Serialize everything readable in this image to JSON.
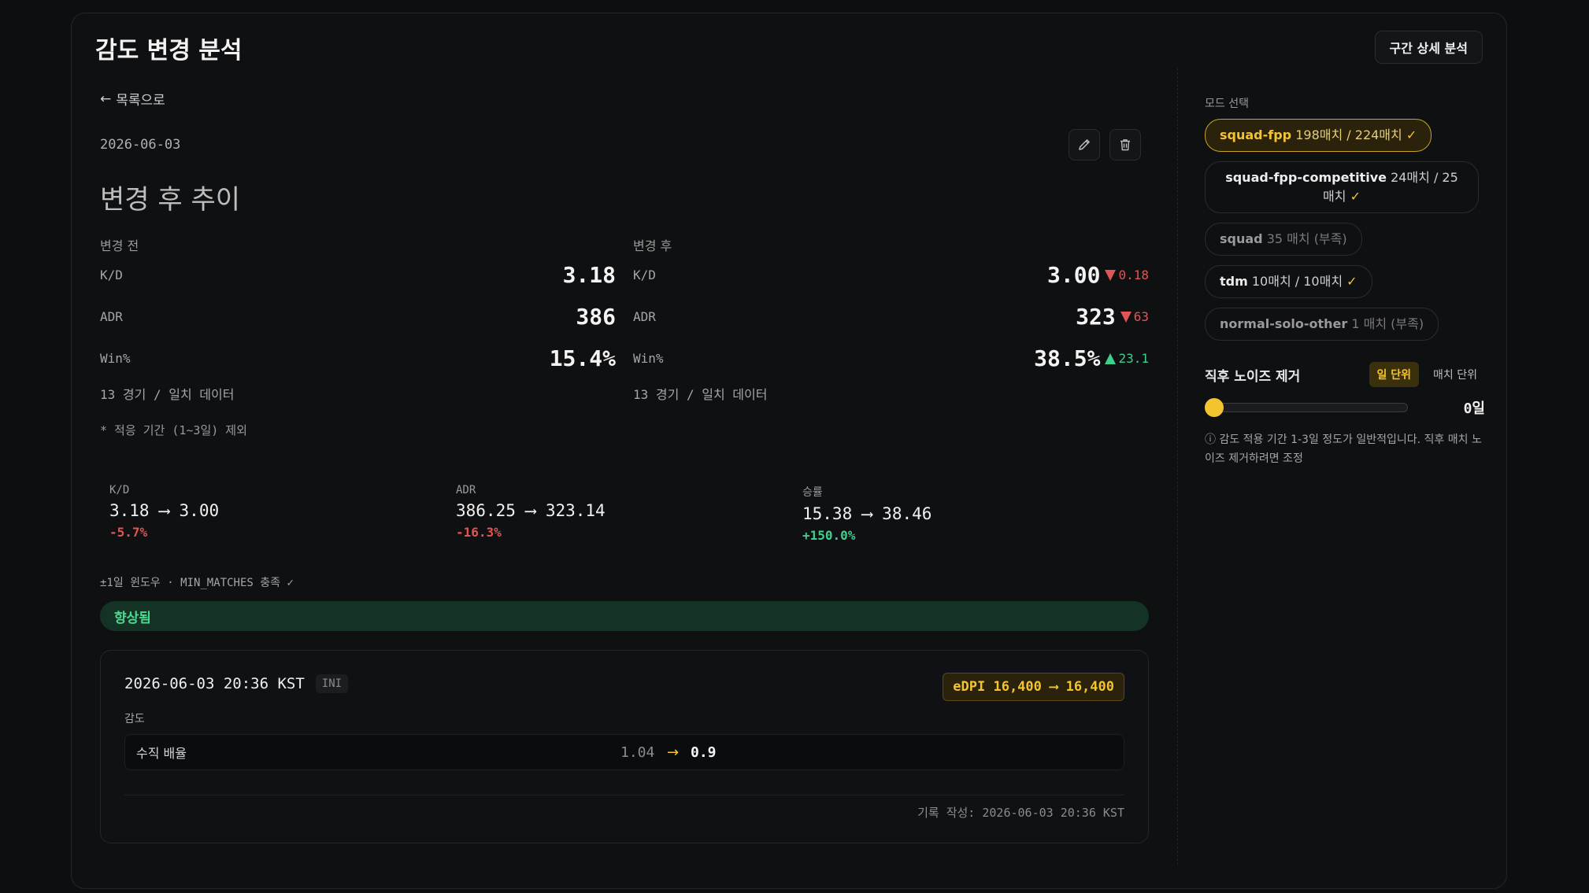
{
  "header": {
    "title": "감도 변경 분석",
    "detail_button": "구간 상세 분석"
  },
  "nav": {
    "back": "목록으로"
  },
  "record": {
    "date": "2026-06-03"
  },
  "section": {
    "title": "변경 후 추이"
  },
  "before": {
    "heading": "변경 전",
    "metrics": [
      {
        "label": "K/D",
        "value": "3.18"
      },
      {
        "label": "ADR",
        "value": "386"
      },
      {
        "label": "Win%",
        "value": "15.4%"
      }
    ],
    "games": "13 경기 / 일치 데이터"
  },
  "after": {
    "heading": "변경 후",
    "metrics": [
      {
        "label": "K/D",
        "value": "3.00",
        "delta": "0.18",
        "direction": "down"
      },
      {
        "label": "ADR",
        "value": "323",
        "delta": "63",
        "direction": "down"
      },
      {
        "label": "Win%",
        "value": "38.5%",
        "delta": "23.1",
        "direction": "up"
      }
    ],
    "games": "13 경기 / 일치 데이터"
  },
  "footnote": "* 적응 기간 (1~3일) 제외",
  "summary": [
    {
      "label": "K/D",
      "from": "3.18",
      "to": "3.00",
      "pct": "-5.7%",
      "direction": "down"
    },
    {
      "label": "ADR",
      "from": "386.25",
      "to": "323.14",
      "pct": "-16.3%",
      "direction": "down"
    },
    {
      "label": "승률",
      "from": "15.38",
      "to": "38.46",
      "pct": "+150.0%",
      "direction": "up"
    }
  ],
  "window_note": "±1일 윈도우 · MIN_MATCHES 충족 ✓",
  "verdict": "향상됨",
  "change_card": {
    "datetime": "2026-06-03 20:36 KST",
    "source": "INI",
    "edpi": "eDPI 16,400 ⟶ 16,400",
    "sens_label": "감도",
    "row": {
      "name": "수직 배율",
      "from": "1.04",
      "arrow": "→",
      "to": "0.9"
    },
    "recorded": "기록 작성: 2026-06-03 20:36 KST"
  },
  "mode": {
    "label": "모드 선택",
    "chips": [
      {
        "name": "squad-fpp",
        "count": "198매치 / 224매치",
        "check": "✓",
        "state": "active"
      },
      {
        "name": "squad-fpp-competitive",
        "count": "24매치 / 25매치",
        "check": "✓",
        "state": "ok"
      },
      {
        "name": "squad",
        "count": "35 매치 (부족)",
        "check": "",
        "state": "weak"
      },
      {
        "name": "tdm",
        "count": "10매치 / 10매치",
        "check": "✓",
        "state": "ok"
      },
      {
        "name": "normal-solo-other",
        "count": "1 매치 (부족)",
        "check": "",
        "state": "weak"
      }
    ]
  },
  "noise": {
    "title": "직후 노이즈 제거",
    "tab_day": "일 단위",
    "tab_match": "매치 단위",
    "value": "0일",
    "hint": "ⓘ 감도 적용 기간 1-3일 정도가 일반적입니다. 직후 매치 노이즈 제거하려면 조정"
  },
  "colors": {
    "accent": "#f4c430",
    "up": "#3fcf8e",
    "down": "#e05555"
  }
}
